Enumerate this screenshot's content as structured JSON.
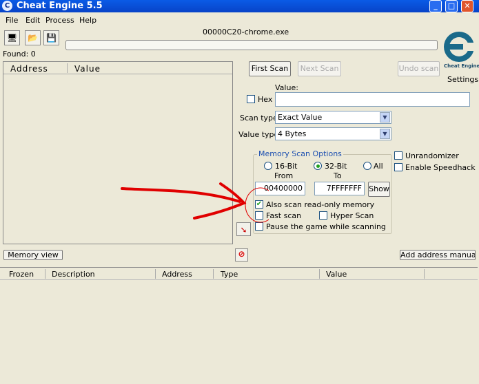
{
  "window": {
    "title": "Cheat Engine 5.5",
    "icon": "cheat-engine-icon",
    "controls": [
      "minimize",
      "maximize",
      "close"
    ]
  },
  "menu": [
    "File",
    "Edit",
    "Process",
    "Help"
  ],
  "toolbar": {
    "icons": [
      "open-process-icon",
      "open-file-icon",
      "save-icon"
    ]
  },
  "process_name": "00000C20-chrome.exe",
  "found": "Found: 0",
  "results_list": {
    "columns": [
      "Address",
      "Value"
    ]
  },
  "scan_buttons": {
    "first": "First Scan",
    "next": "Next Scan",
    "undo": "Undo scan"
  },
  "logo": {
    "text": "Cheat Engine",
    "settings": "Settings"
  },
  "value": {
    "label": "Value:",
    "hex_label": "Hex",
    "input": ""
  },
  "scan_type": {
    "label": "Scan type",
    "selected": "Exact Value"
  },
  "value_type": {
    "label": "Value type",
    "selected": "4 Bytes"
  },
  "memory_options": {
    "title": "Memory Scan Options",
    "bits": [
      "16-Bit",
      "32-Bit",
      "All"
    ],
    "selected_bit": "32-Bit",
    "from_label": "From",
    "to_label": "To",
    "from_value": "00400000",
    "to_value": "7FFFFFFF",
    "show_label": "Show",
    "readonly_label": "Also scan read-only memory",
    "readonly_checked": true,
    "fast_label": "Fast scan",
    "hyper_label": "Hyper Scan",
    "pause_label": "Pause the game while scanning"
  },
  "extras": {
    "unrandomizer": "Unrandomizer",
    "speedhack": "Enable Speedhack"
  },
  "memory_view_button": "Memory view",
  "add_address_button": "Add address manually",
  "address_list": {
    "columns": [
      "Frozen",
      "Description",
      "Address",
      "Type",
      "Value"
    ]
  },
  "annotation_color": "#e00000"
}
